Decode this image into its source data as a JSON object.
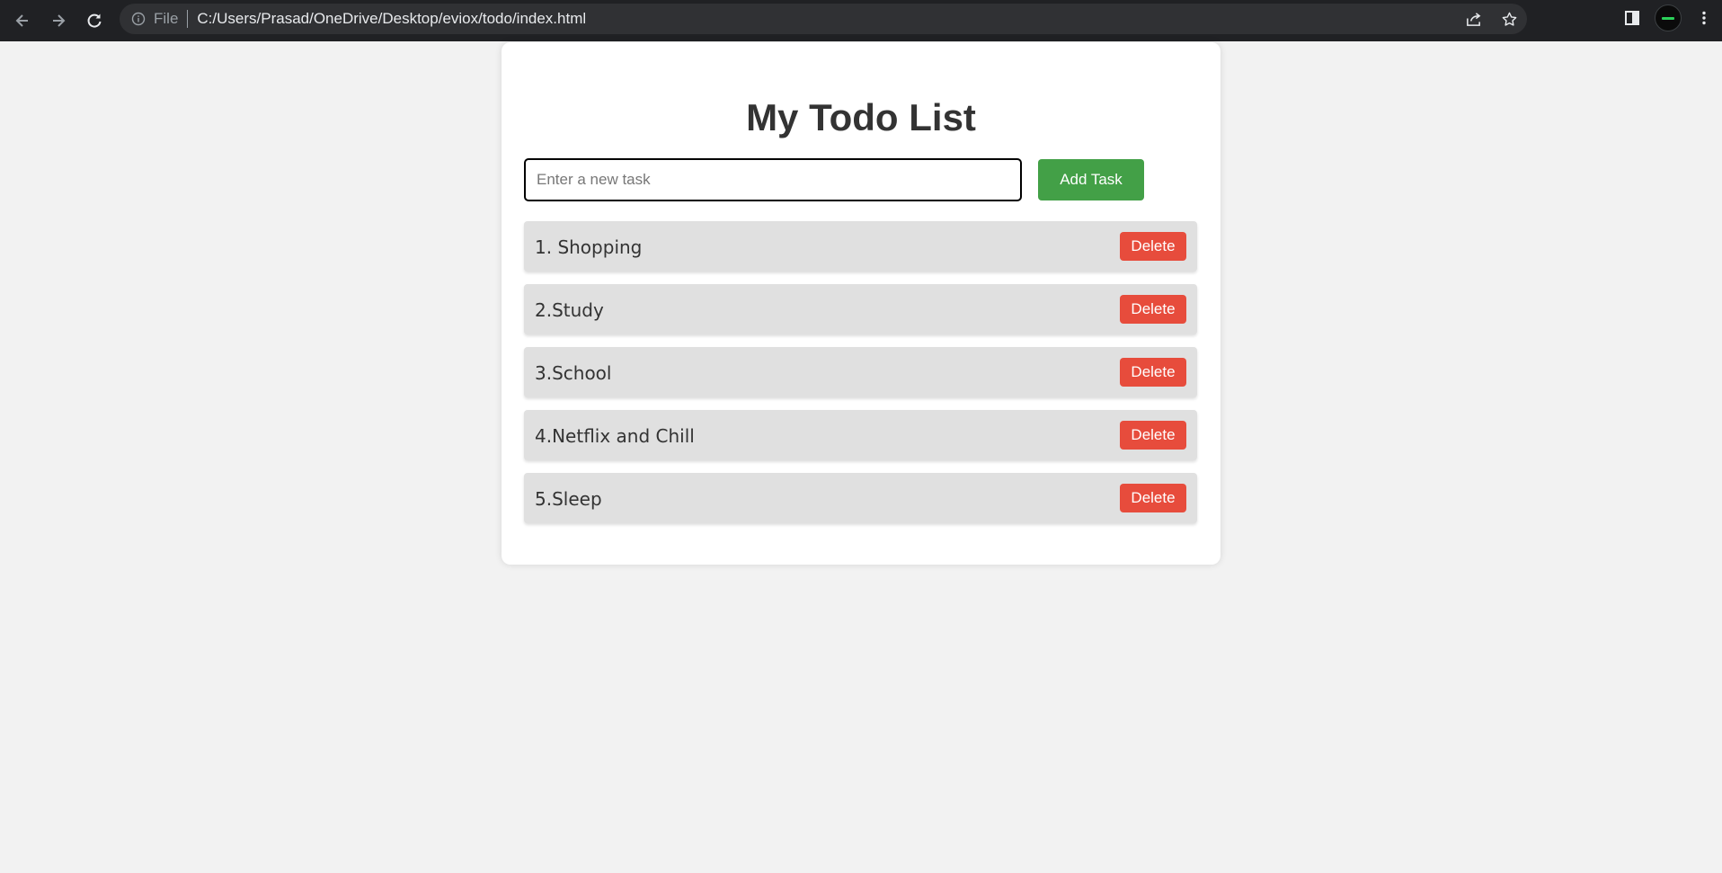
{
  "browser": {
    "file_label": "File",
    "url": "C:/Users/Prasad/OneDrive/Desktop/eviox/todo/index.html",
    "icons": {
      "back": "arrow-left-icon",
      "forward": "arrow-right-icon",
      "reload": "reload-icon",
      "info": "info-icon",
      "share": "share-icon",
      "bookmark": "star-icon",
      "side_panel": "side-panel-icon",
      "menu": "kebab-menu-icon"
    }
  },
  "app": {
    "title": "My Todo List",
    "input_placeholder": "Enter a new task",
    "input_value": "",
    "add_button_label": "Add Task",
    "tasks": [
      {
        "text": "1. Shopping",
        "delete_label": "Delete"
      },
      {
        "text": "2.Study",
        "delete_label": "Delete"
      },
      {
        "text": "3.School",
        "delete_label": "Delete"
      },
      {
        "text": "4.Netflix and Chill",
        "delete_label": "Delete"
      },
      {
        "text": "5.Sleep",
        "delete_label": "Delete"
      }
    ]
  },
  "colors": {
    "page_background": "#f2f2f2",
    "card_background": "#ffffff",
    "add_button": "#43a047",
    "delete_button": "#e74c3c",
    "task_background": "#e0e0e0",
    "browser_bar": "#202124"
  }
}
